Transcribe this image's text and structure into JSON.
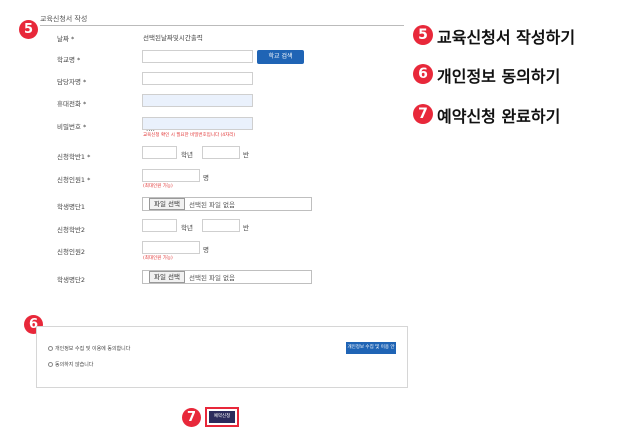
{
  "badges": {
    "form": "5",
    "consent": "6",
    "submit": "7"
  },
  "headings": [
    {
      "num": "5",
      "text": "교육신청서 작성하기"
    },
    {
      "num": "6",
      "text": "개인정보 동의하기"
    },
    {
      "num": "7",
      "text": "예약신청 완료하기"
    }
  ],
  "form": {
    "title": "교육신청서 작성",
    "date_label": "날짜 *",
    "date_value": "선택된날짜및시간출력",
    "school_label": "학교명 *",
    "school_search_button": "학교 검색",
    "teacher_label": "담당자명 *",
    "phone_label": "휴대전화 *",
    "password_label": "비밀번호 *",
    "password_value": "····",
    "password_hint": "교육신청 확인 시 필요한 비밀번호입니다 (4자리)",
    "class1_label": "신청학반1 *",
    "class1_grade_suffix": "학년",
    "class1_class_suffix": "반",
    "count1_label": "신청인원1 *",
    "count1_suffix": "명",
    "count1_hint": "(최대인원 가능)",
    "list1_label": "학생명단1",
    "file_button": "파일 선택",
    "file_none": "선택된 파일 없음",
    "class2_label": "신청학반2",
    "class2_grade_suffix": "학년",
    "class2_class_suffix": "반",
    "count2_label": "신청인원2",
    "count2_suffix": "명",
    "count2_hint": "(최대인원 가능)",
    "list2_label": "학생명단2"
  },
  "consent": {
    "agree_label": "개인정보 수집 및 이용에 동의합니다",
    "disagree_label": "동의하지 않습니다",
    "view_button": "개인정보 수집 및 이용 안내"
  },
  "submit": {
    "label": "예약신청"
  },
  "colors": {
    "badge": "#e8283a",
    "primary_button": "#1f64b5",
    "submit_button": "#2b2b5c"
  }
}
